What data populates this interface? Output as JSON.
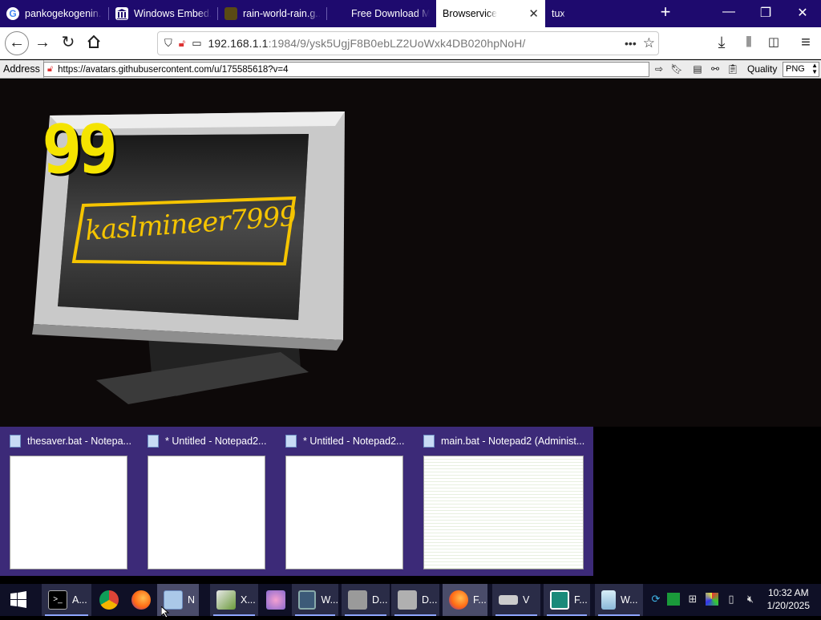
{
  "tabs": [
    {
      "label": "pankogekogenin..."
    },
    {
      "label": "Windows Embed..."
    },
    {
      "label": "rain-world-rain.g..."
    },
    {
      "label": "Free Download M..."
    },
    {
      "label": "Browservice",
      "active": true
    },
    {
      "label": "tux"
    }
  ],
  "nav": {
    "url_host": "192.168.1.1",
    "url_rest": ":1984/9/ysk5UgjF8B0ebLZ2UoWxk4DB020hpNoH/",
    "more": "•••"
  },
  "addressbar": {
    "label": "Address",
    "url": "https://avatars.githubusercontent.com/u/175585618?v=4",
    "quality_label": "Quality",
    "quality_value": "PNG"
  },
  "page": {
    "badge": "99",
    "screen_text": "kaslmineer7999"
  },
  "thumbnails": [
    {
      "title": "thesaver.bat - Notepa..."
    },
    {
      "title": "* Untitled - Notepad2..."
    },
    {
      "title": "* Untitled - Notepad2..."
    },
    {
      "title": "main.bat - Notepad2 (Administ..."
    }
  ],
  "taskbar": {
    "items": [
      {
        "label": "A..."
      },
      {
        "label": "N"
      },
      {
        "label": "X..."
      },
      {
        "label": "W..."
      },
      {
        "label": "D..."
      },
      {
        "label": "D..."
      },
      {
        "label": "F..."
      },
      {
        "label": "V"
      },
      {
        "label": "F..."
      },
      {
        "label": "W..."
      }
    ],
    "time": "10:32 AM",
    "date": "1/20/2025"
  }
}
